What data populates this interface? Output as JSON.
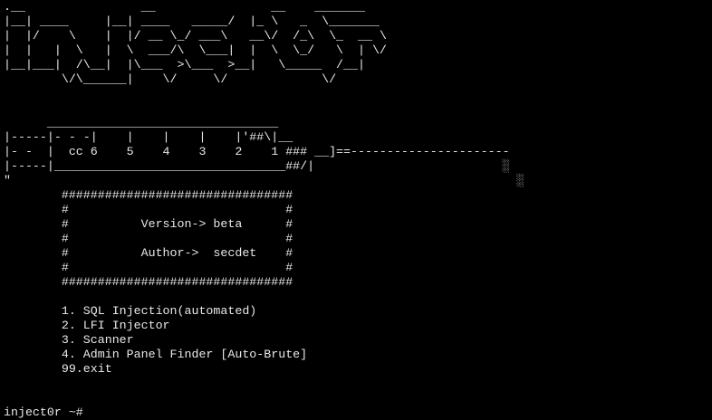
{
  "terminal": {
    "lines": [
      ".__                __                __    _______",
      "|__| ____     |__| ____   _____/  |_ \\   _  \\_______",
      "|  |/    \\    |  |/ __ \\_/ ___\\   __\\/  /_\\  \\_  __ \\",
      "|  |   |  \\   |  \\  ___/\\  \\___|  |  \\  \\_/   \\  | \\/",
      "|__|___|  /\\__|  |\\___  >\\___  >__|   \\_____  /__|",
      "        \\/\\______|    \\/     \\/             \\/",
      "",
      "",
      "      ________________________________",
      "|-----|- - -|    |    |    |    |'##\\|__",
      "|- -  |  cc 6    5    4    3    2    1 ### __]==----------------------",
      "|-----|________________________________##/|                          ░",
      "\"                                                                      ░",
      "        ################################",
      "        #                              #",
      "        #          Version-> beta      #",
      "        #                              #",
      "        #          Author->  secdet    #",
      "        #                              #",
      "        ################################",
      "",
      "        1. SQL Injection(automated)",
      "        2. LFI Injector",
      "        3. Scanner",
      "        4. Admin Panel Finder [Auto-Brute]",
      "        99.exit",
      "",
      ""
    ],
    "prompt": "inject0r ~# "
  }
}
